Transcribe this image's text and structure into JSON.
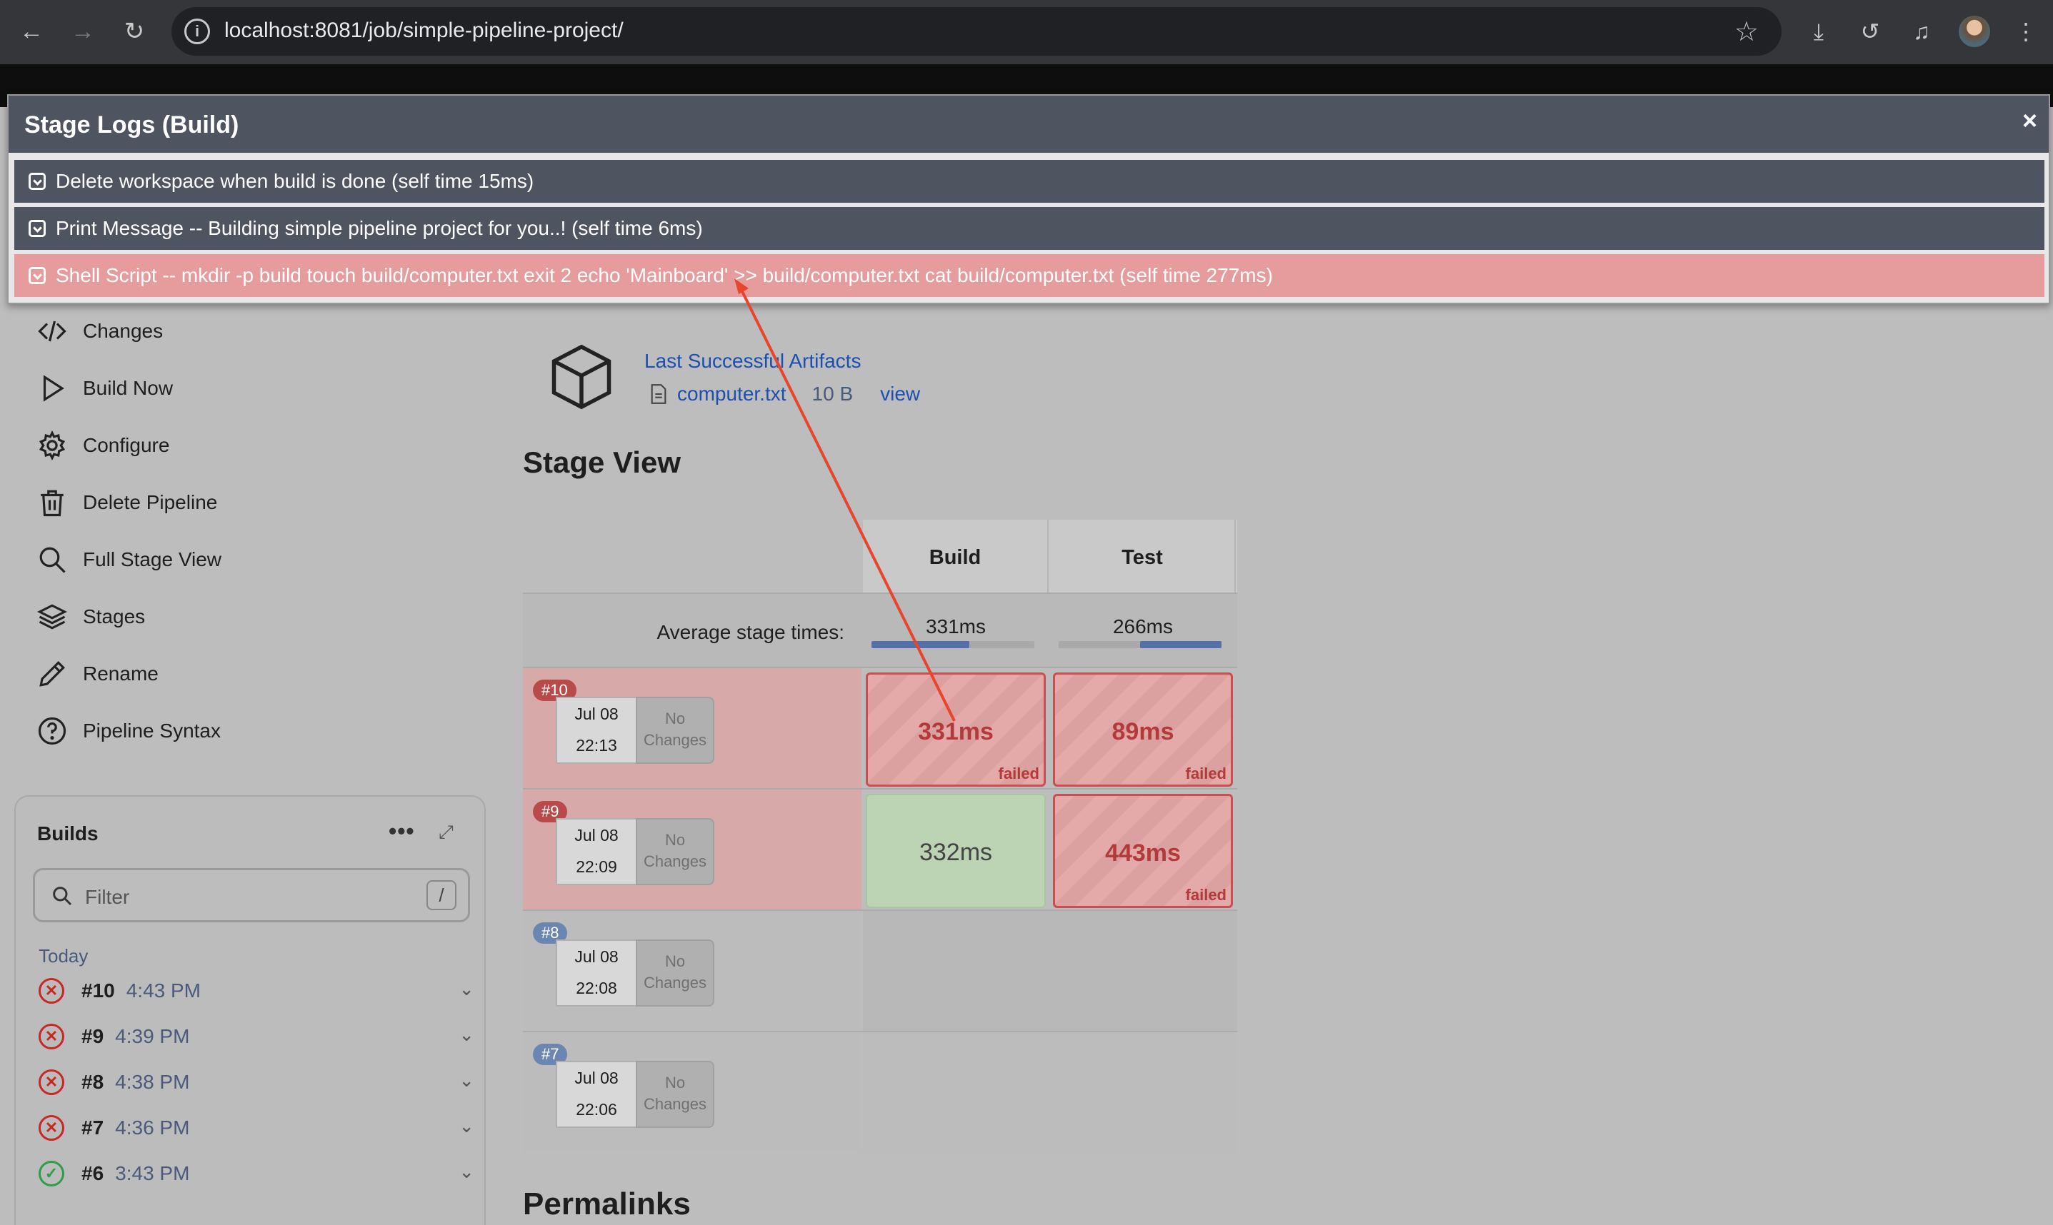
{
  "browser": {
    "url": "localhost:8081/job/simple-pipeline-project/"
  },
  "sidebar": {
    "items": [
      {
        "label": "Changes",
        "icon": "code-icon"
      },
      {
        "label": "Build Now",
        "icon": "play-icon"
      },
      {
        "label": "Configure",
        "icon": "gear-icon"
      },
      {
        "label": "Delete Pipeline",
        "icon": "trash-icon"
      },
      {
        "label": "Full Stage View",
        "icon": "search-icon"
      },
      {
        "label": "Stages",
        "icon": "layers-icon"
      },
      {
        "label": "Rename",
        "icon": "pencil-icon"
      },
      {
        "label": "Pipeline Syntax",
        "icon": "help-icon"
      }
    ]
  },
  "builds": {
    "title": "Builds",
    "filter_placeholder": "Filter",
    "filter_shortcut": "/",
    "group": "Today",
    "rows": [
      {
        "num": "#10",
        "time": "4:43 PM",
        "status": "failed"
      },
      {
        "num": "#9",
        "time": "4:39 PM",
        "status": "failed"
      },
      {
        "num": "#8",
        "time": "4:38 PM",
        "status": "failed"
      },
      {
        "num": "#7",
        "time": "4:36 PM",
        "status": "failed"
      },
      {
        "num": "#6",
        "time": "3:43 PM",
        "status": "success"
      }
    ]
  },
  "artifacts": {
    "title": "Last Successful Artifacts",
    "file": "computer.txt",
    "size": "10 B",
    "view": "view"
  },
  "stage_view": {
    "title": "Stage View",
    "columns": [
      "Build",
      "Test"
    ],
    "avg_label": "Average stage times:",
    "avg_times": [
      "331ms",
      "266ms"
    ],
    "avg_fill": [
      0.6,
      0.5
    ],
    "runs": [
      {
        "badge": "#10",
        "date": "Jul 08",
        "time": "22:13",
        "changes_a": "No",
        "changes_b": "Changes",
        "cells": [
          {
            "dur": "331ms",
            "status": "failed",
            "label": "failed"
          },
          {
            "dur": "89ms",
            "status": "failed",
            "label": "failed"
          }
        ]
      },
      {
        "badge": "#9",
        "date": "Jul 08",
        "time": "22:09",
        "changes_a": "No",
        "changes_b": "Changes",
        "cells": [
          {
            "dur": "332ms",
            "status": "success",
            "label": ""
          },
          {
            "dur": "443ms",
            "status": "failed",
            "label": "failed"
          }
        ]
      },
      {
        "badge": "#8",
        "date": "Jul 08",
        "time": "22:08",
        "changes_a": "No",
        "changes_b": "Changes",
        "cells": []
      },
      {
        "badge": "#7",
        "date": "Jul 08",
        "time": "22:06",
        "changes_a": "No",
        "changes_b": "Changes",
        "cells": []
      }
    ]
  },
  "permalinks": {
    "title": "Permalinks"
  },
  "modal": {
    "title": "Stage Logs (Build)",
    "close": "×",
    "logs": [
      {
        "text": "Delete workspace when build is done (self time 15ms)",
        "status": "ok"
      },
      {
        "text": "Print Message -- Building simple pipeline project for you..! (self time 6ms)",
        "status": "ok"
      },
      {
        "text": "Shell Script -- mkdir -p build touch build/computer.txt exit 2 echo 'Mainboard' >> build/computer.txt cat build/computer.txt (self time 277ms)",
        "status": "error"
      }
    ]
  },
  "colors": {
    "failed": "#c85050",
    "success": "#2e9d4a",
    "link": "#1b4fb0",
    "annotation_arrow": "#e8452c"
  }
}
